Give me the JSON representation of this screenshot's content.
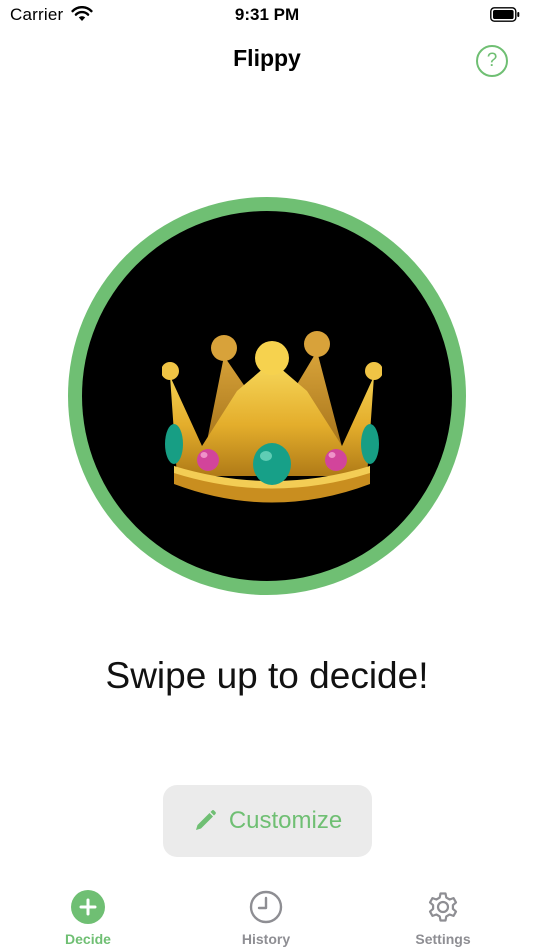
{
  "status_bar": {
    "carrier": "Carrier",
    "time": "9:31 PM",
    "wifi_icon": "wifi-icon",
    "battery_icon": "battery-icon"
  },
  "nav": {
    "title": "Flippy",
    "help_label": "?",
    "help_icon": "question-circle-icon"
  },
  "coin": {
    "emoji_icon": "crown-icon"
  },
  "prompt": "Swipe up to decide!",
  "customize": {
    "label": "Customize",
    "icon": "pencil-icon"
  },
  "tabs": [
    {
      "label": "Decide",
      "icon": "plus-circle-icon",
      "active": true
    },
    {
      "label": "History",
      "icon": "clock-icon",
      "active": false
    },
    {
      "label": "Settings",
      "icon": "gear-icon",
      "active": false
    }
  ],
  "colors": {
    "accent": "#6fbf73",
    "inactive": "#8e8e93",
    "button_bg": "#ebebeb",
    "coin_face": "#000000"
  }
}
